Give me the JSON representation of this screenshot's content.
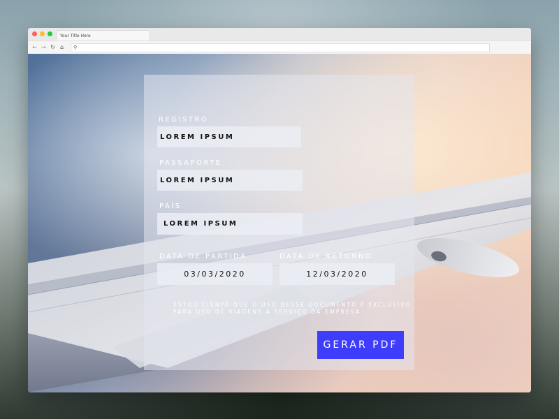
{
  "browser": {
    "tab_title": "Your Title Here"
  },
  "form": {
    "registro": {
      "label": "REGISTRO",
      "value": "LOREM IPSUM"
    },
    "passaporte": {
      "label": "PASSAPORTE",
      "value": "LOREM IPSUM"
    },
    "pais": {
      "label": "PAÍS",
      "value": "LOREM IPSUM"
    },
    "data_partida": {
      "label": "DATA DE PARTIDA",
      "value": "03/03/2020"
    },
    "data_retorno": {
      "label": "DATA DE RETORNO",
      "value": "12/03/2020"
    },
    "notice": "ESTOU CIENTE QUE O USO DESSE DOCUMENTO É EXCLUSIVO PARA USO DE VIAGENS A SERVIÇO DA EMPRESA",
    "submit_label": "GERAR PDF"
  },
  "colors": {
    "accent": "#3d3dfb"
  }
}
